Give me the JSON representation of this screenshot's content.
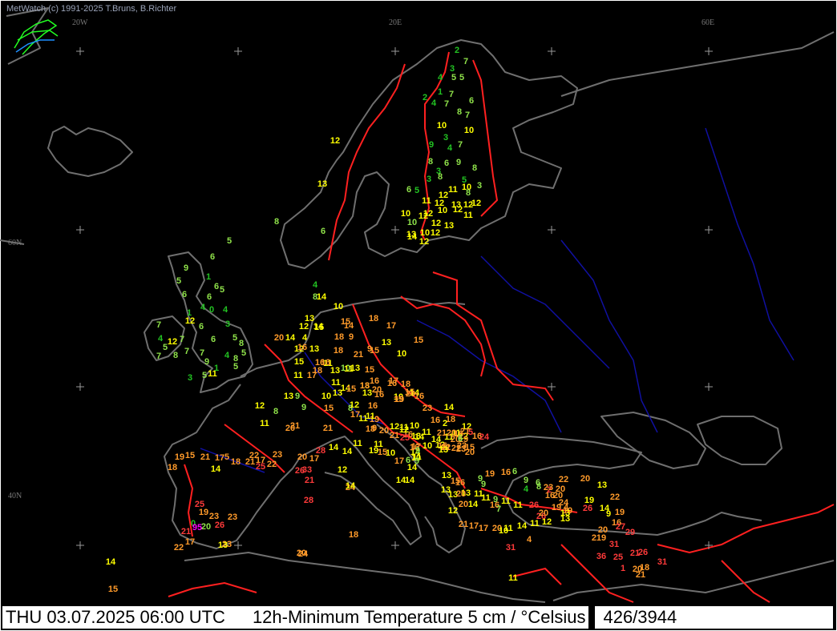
{
  "credit": "MetWatch  (c) 1991-2025 T.Bruns, B.Richter",
  "status_bar": {
    "datetime": "THU 03.07.2025 06:00 UTC",
    "title": "12h-Minimum Temperature 5 cm  / °Celsius",
    "count": "426/3944"
  },
  "grid_labels": [
    "20W",
    "20E",
    "60E",
    "60N",
    "40N"
  ],
  "colors": {
    "cold": "#22c322",
    "cool": "#8fe24a",
    "mild": "#ffff00",
    "warm": "#ff9a2a",
    "hot": "#ff3a3a",
    "extreme": "#ff00ff",
    "coast": "#6f6f6f",
    "border": "#ff2020",
    "river": "#1010a0"
  },
  "stations": [
    [
      "2",
      "c"
    ],
    [
      "7",
      "l"
    ],
    [
      "4",
      "c"
    ],
    [
      "3",
      "c"
    ],
    [
      "5",
      "l"
    ],
    [
      "5",
      "l"
    ],
    [
      "1",
      "c"
    ],
    [
      "7",
      "l"
    ],
    [
      "2",
      "c"
    ],
    [
      "4",
      "c"
    ],
    [
      "6",
      "l"
    ],
    [
      "7",
      "l"
    ],
    [
      "8",
      "l"
    ],
    [
      "7",
      "l"
    ],
    [
      "10",
      "m"
    ],
    [
      "3",
      "c"
    ],
    [
      "10",
      "m"
    ],
    [
      "9",
      "c"
    ],
    [
      "4",
      "c"
    ],
    [
      "7",
      "l"
    ],
    [
      "8",
      "l"
    ],
    [
      "3",
      "c"
    ],
    [
      "6",
      "l"
    ],
    [
      "9",
      "l"
    ],
    [
      "8",
      "l"
    ],
    [
      "5",
      "c"
    ],
    [
      "3",
      "c"
    ],
    [
      "8",
      "l"
    ],
    [
      "6",
      "l"
    ],
    [
      "5",
      "c"
    ],
    [
      "12",
      "m"
    ],
    [
      "11",
      "m"
    ],
    [
      "10",
      "m"
    ],
    [
      "3",
      "l"
    ],
    [
      "8",
      "l"
    ],
    [
      "11",
      "m"
    ],
    [
      "12",
      "m"
    ],
    [
      "13",
      "m"
    ],
    [
      "12",
      "m"
    ],
    [
      "10",
      "m"
    ],
    [
      "12",
      "m"
    ],
    [
      "10",
      "m"
    ],
    [
      "12",
      "m"
    ],
    [
      "12",
      "m"
    ],
    [
      "11",
      "m"
    ],
    [
      "12",
      "m"
    ],
    [
      "13",
      "m"
    ],
    [
      "10",
      "l"
    ],
    [
      "12",
      "m"
    ],
    [
      "13",
      "m"
    ],
    [
      "14",
      "m"
    ],
    [
      "12",
      "m"
    ],
    [
      "10",
      "m"
    ],
    [
      "12",
      "m"
    ],
    [
      "12",
      "m"
    ],
    [
      "13",
      "m"
    ],
    [
      "8",
      "l"
    ],
    [
      "6",
      "l"
    ],
    [
      "5",
      "l"
    ],
    [
      "6",
      "l"
    ],
    [
      "9",
      "l"
    ],
    [
      "1",
      "c"
    ],
    [
      "5",
      "l"
    ],
    [
      "6",
      "l"
    ],
    [
      "6",
      "l"
    ],
    [
      "1",
      "c"
    ],
    [
      "5",
      "l"
    ],
    [
      "6",
      "l"
    ],
    [
      "4",
      "c"
    ],
    [
      "0",
      "c"
    ],
    [
      "4",
      "c"
    ],
    [
      "3",
      "c"
    ],
    [
      "7",
      "l"
    ],
    [
      "12",
      "m"
    ],
    [
      "6",
      "l"
    ],
    [
      "4",
      "c"
    ],
    [
      "12",
      "m"
    ],
    [
      "7",
      "l"
    ],
    [
      "6",
      "l"
    ],
    [
      "5",
      "l"
    ],
    [
      "5",
      "l"
    ],
    [
      "8",
      "l"
    ],
    [
      "8",
      "l"
    ],
    [
      "7",
      "l"
    ],
    [
      "7",
      "l"
    ],
    [
      "7",
      "l"
    ],
    [
      "3",
      "c"
    ],
    [
      "5",
      "l"
    ],
    [
      "8",
      "l"
    ],
    [
      "9",
      "l"
    ],
    [
      "4",
      "c"
    ],
    [
      "11",
      "m"
    ],
    [
      "5",
      "l"
    ],
    [
      "5",
      "l"
    ],
    [
      "1",
      "c"
    ],
    [
      "4",
      "c"
    ],
    [
      "8",
      "l"
    ],
    [
      "14",
      "m"
    ],
    [
      "10",
      "m"
    ],
    [
      "13",
      "m"
    ],
    [
      "12",
      "m"
    ],
    [
      "14",
      "m"
    ],
    [
      "15",
      "m"
    ],
    [
      "15",
      "w"
    ],
    [
      "14",
      "w"
    ],
    [
      "18",
      "w"
    ],
    [
      "9",
      "w"
    ],
    [
      "18",
      "w"
    ],
    [
      "17",
      "w"
    ],
    [
      "20",
      "w"
    ],
    [
      "14",
      "m"
    ],
    [
      "12",
      "m"
    ],
    [
      "13",
      "m"
    ],
    [
      "4",
      "m"
    ],
    [
      "16",
      "w"
    ],
    [
      "18",
      "w"
    ],
    [
      "21",
      "w"
    ],
    [
      "9",
      "w"
    ],
    [
      "15",
      "w"
    ],
    [
      "13",
      "m"
    ],
    [
      "10",
      "m"
    ],
    [
      "15",
      "w"
    ],
    [
      "11",
      "m"
    ],
    [
      "15",
      "m"
    ],
    [
      "11",
      "m"
    ],
    [
      "17",
      "w"
    ],
    [
      "16",
      "w"
    ],
    [
      "18",
      "w"
    ],
    [
      "16",
      "w"
    ],
    [
      "13",
      "m"
    ],
    [
      "11",
      "m"
    ],
    [
      "10",
      "l"
    ],
    [
      "11",
      "m"
    ],
    [
      "13",
      "m"
    ],
    [
      "15",
      "w"
    ],
    [
      "16",
      "w"
    ],
    [
      "17",
      "w"
    ],
    [
      "18",
      "w"
    ],
    [
      "13",
      "m"
    ],
    [
      "14",
      "m"
    ],
    [
      "13",
      "m"
    ],
    [
      "15",
      "w"
    ],
    [
      "18",
      "w"
    ],
    [
      "20",
      "w"
    ],
    [
      "16",
      "w"
    ],
    [
      "13",
      "m"
    ],
    [
      "10",
      "m"
    ],
    [
      "15",
      "w"
    ],
    [
      "14",
      "m"
    ],
    [
      "16",
      "w"
    ],
    [
      "19",
      "w"
    ],
    [
      "16",
      "w"
    ],
    [
      "13",
      "m"
    ],
    [
      "9",
      "l"
    ],
    [
      "10",
      "m"
    ],
    [
      "9",
      "l"
    ],
    [
      "15",
      "w"
    ],
    [
      "8",
      "l"
    ],
    [
      "12",
      "m"
    ],
    [
      "17",
      "w"
    ],
    [
      "11",
      "m"
    ],
    [
      "19",
      "w"
    ],
    [
      "11",
      "m"
    ],
    [
      "16",
      "w"
    ],
    [
      "19",
      "w"
    ],
    [
      "20",
      "w"
    ],
    [
      "23",
      "w"
    ],
    [
      "14",
      "m"
    ],
    [
      "18",
      "w"
    ],
    [
      "16",
      "w"
    ],
    [
      "12",
      "m"
    ],
    [
      "11",
      "m"
    ],
    [
      "10",
      "m"
    ],
    [
      "12",
      "m"
    ],
    [
      "8",
      "l"
    ],
    [
      "11",
      "m"
    ],
    [
      "21",
      "w"
    ],
    [
      "20",
      "w"
    ],
    [
      "21",
      "w"
    ],
    [
      "18",
      "w"
    ],
    [
      "9",
      "w"
    ],
    [
      "20",
      "w"
    ],
    [
      "21",
      "w"
    ],
    [
      "16",
      "w"
    ],
    [
      "14",
      "m"
    ],
    [
      "12",
      "m"
    ],
    [
      "13",
      "m"
    ],
    [
      "11",
      "m"
    ],
    [
      "14",
      "m"
    ],
    [
      "12",
      "m"
    ],
    [
      "11",
      "m"
    ],
    [
      "12",
      "m"
    ],
    [
      "16",
      "w"
    ],
    [
      "6",
      "w"
    ],
    [
      "15",
      "w"
    ],
    [
      "22",
      "w"
    ],
    [
      "23",
      "w"
    ],
    [
      "16",
      "w"
    ],
    [
      "24",
      "h"
    ],
    [
      "21",
      "w"
    ],
    [
      "11",
      "m"
    ],
    [
      "12",
      "m"
    ],
    [
      "14",
      "m"
    ],
    [
      "11",
      "m"
    ],
    [
      "19",
      "m"
    ],
    [
      "12",
      "m"
    ],
    [
      "11",
      "m"
    ],
    [
      "10",
      "m"
    ],
    [
      "15",
      "w"
    ],
    [
      "17",
      "w"
    ],
    [
      "16",
      "w"
    ],
    [
      "21",
      "w"
    ],
    [
      "20",
      "w"
    ],
    [
      "19",
      "w"
    ],
    [
      "22",
      "w"
    ],
    [
      "25",
      "h"
    ],
    [
      "5",
      "h"
    ],
    [
      "20",
      "w"
    ],
    [
      "23",
      "w"
    ],
    [
      "20",
      "w"
    ],
    [
      "21",
      "w"
    ],
    [
      "14",
      "m"
    ],
    [
      "6",
      "l"
    ],
    [
      "10",
      "m"
    ],
    [
      "10",
      "m"
    ],
    [
      "16",
      "w"
    ],
    [
      "11",
      "m"
    ],
    [
      "14",
      "m"
    ],
    [
      "17",
      "w"
    ],
    [
      "9",
      "l"
    ],
    [
      "9",
      "l"
    ],
    [
      "13",
      "m"
    ],
    [
      "2",
      "m"
    ],
    [
      "6",
      "l"
    ],
    [
      "19",
      "w"
    ],
    [
      "15",
      "w"
    ],
    [
      "18",
      "w"
    ],
    [
      "21",
      "w"
    ],
    [
      "17",
      "w"
    ],
    [
      "14",
      "m"
    ],
    [
      "5",
      "w"
    ],
    [
      "18",
      "w"
    ],
    [
      "21",
      "w"
    ],
    [
      "22",
      "w"
    ],
    [
      "25",
      "h"
    ],
    [
      "17",
      "w"
    ],
    [
      "22",
      "w"
    ],
    [
      "23",
      "w"
    ],
    [
      "20",
      "w"
    ],
    [
      "17",
      "w"
    ],
    [
      "26",
      "h"
    ],
    [
      "28",
      "h"
    ],
    [
      "14",
      "m"
    ],
    [
      "21",
      "h"
    ],
    [
      "24",
      "w"
    ],
    [
      "24",
      "w"
    ],
    [
      "23",
      "w"
    ],
    [
      "21",
      "h"
    ],
    [
      "19",
      "w"
    ],
    [
      "23",
      "w"
    ],
    [
      "25",
      "h"
    ],
    [
      "0",
      "c"
    ],
    [
      "22",
      "w"
    ],
    [
      "20",
      "l"
    ],
    [
      "26",
      "h"
    ],
    [
      "23",
      "w"
    ],
    [
      "33",
      "h"
    ],
    [
      "28",
      "h"
    ],
    [
      "14",
      "m"
    ],
    [
      "95",
      "x"
    ],
    [
      "18",
      "w"
    ],
    [
      "20",
      "w"
    ],
    [
      "13",
      "m"
    ],
    [
      "17",
      "w"
    ],
    [
      "14",
      "m"
    ],
    [
      "15",
      "w"
    ],
    [
      "14",
      "m"
    ],
    [
      "14",
      "m"
    ],
    [
      "13",
      "m"
    ],
    [
      "15",
      "w"
    ],
    [
      "16",
      "w"
    ],
    [
      "9",
      "l"
    ],
    [
      "19",
      "w"
    ],
    [
      "16",
      "w"
    ],
    [
      "6",
      "l"
    ],
    [
      "9",
      "l"
    ],
    [
      "6",
      "l"
    ],
    [
      "9",
      "l"
    ],
    [
      "13",
      "m"
    ],
    [
      "13",
      "m"
    ],
    [
      "11",
      "m"
    ],
    [
      "11",
      "m"
    ],
    [
      "16",
      "w"
    ],
    [
      "7",
      "l"
    ],
    [
      "11",
      "m"
    ],
    [
      "9",
      "l"
    ],
    [
      "4",
      "c"
    ],
    [
      "16",
      "w"
    ],
    [
      "8",
      "l"
    ],
    [
      "20",
      "w"
    ],
    [
      "22",
      "w"
    ],
    [
      "2",
      "h"
    ],
    [
      "20",
      "w"
    ],
    [
      "19",
      "w"
    ],
    [
      "23",
      "w"
    ],
    [
      "24",
      "w"
    ],
    [
      "26",
      "h"
    ],
    [
      "19",
      "w"
    ],
    [
      "20",
      "w"
    ],
    [
      "21",
      "w"
    ],
    [
      "12",
      "m"
    ],
    [
      "13",
      "m"
    ],
    [
      "20",
      "w"
    ],
    [
      "20",
      "w"
    ],
    [
      "14",
      "m"
    ],
    [
      "17",
      "w"
    ],
    [
      "17",
      "w"
    ],
    [
      "11",
      "m"
    ],
    [
      "20",
      "w"
    ],
    [
      "10",
      "m"
    ],
    [
      "11",
      "m"
    ],
    [
      "14",
      "m"
    ],
    [
      "11",
      "m"
    ],
    [
      "12",
      "m"
    ],
    [
      "13",
      "m"
    ],
    [
      "13",
      "m"
    ],
    [
      "26",
      "h"
    ],
    [
      "20",
      "w"
    ],
    [
      "4",
      "w"
    ],
    [
      "11",
      "m"
    ],
    [
      "4",
      "w"
    ],
    [
      "31",
      "h"
    ],
    [
      "13",
      "m"
    ],
    [
      "19",
      "m"
    ],
    [
      "26",
      "h"
    ],
    [
      "14",
      "m"
    ],
    [
      "9",
      "m"
    ],
    [
      "22",
      "w"
    ],
    [
      "20",
      "w"
    ],
    [
      "16",
      "w"
    ],
    [
      "29",
      "h"
    ],
    [
      "19",
      "w"
    ],
    [
      "27",
      "h"
    ],
    [
      "219",
      "w"
    ],
    [
      "31",
      "h"
    ],
    [
      "36",
      "h"
    ],
    [
      "25",
      "h"
    ],
    [
      "21",
      "h"
    ],
    [
      "26",
      "h"
    ],
    [
      "31",
      "h"
    ],
    [
      "21",
      "w"
    ],
    [
      "18",
      "w"
    ],
    [
      "20",
      "w"
    ],
    [
      "1",
      "h"
    ]
  ]
}
